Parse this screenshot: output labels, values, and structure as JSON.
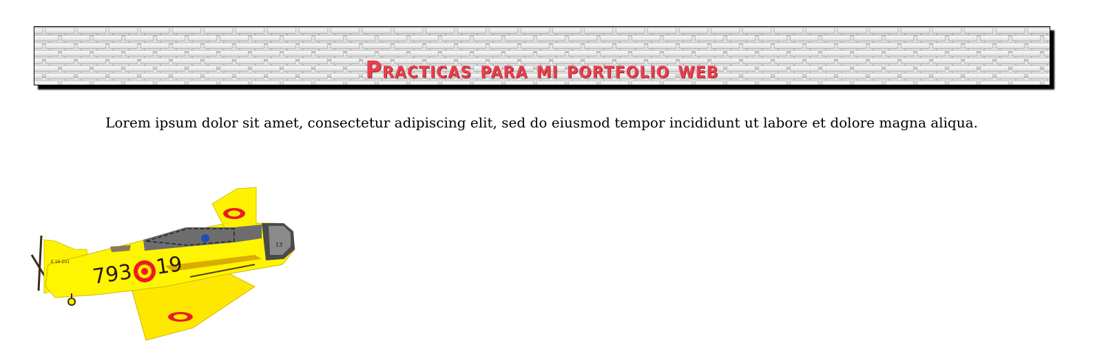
{
  "header": {
    "title": "Practicas para mi portfolio web"
  },
  "main": {
    "intro_text": "Lorem ipsum dolor sit amet, consectetur adipiscing elit, sed do eiusmod tempor incididunt ut labore et dolore magna aliqua.",
    "image": {
      "subject": "yellow-trainer-airplane",
      "markings": [
        "793",
        "19",
        "E.16-201",
        "13"
      ],
      "colors": {
        "body": "#ffee00",
        "roundel_outer": "#e81c24",
        "roundel_inner": "#ffe600",
        "trim": "#3a2a1a"
      }
    }
  },
  "theme": {
    "title_color": "#e8404d",
    "banner_bg": "#dedede"
  }
}
